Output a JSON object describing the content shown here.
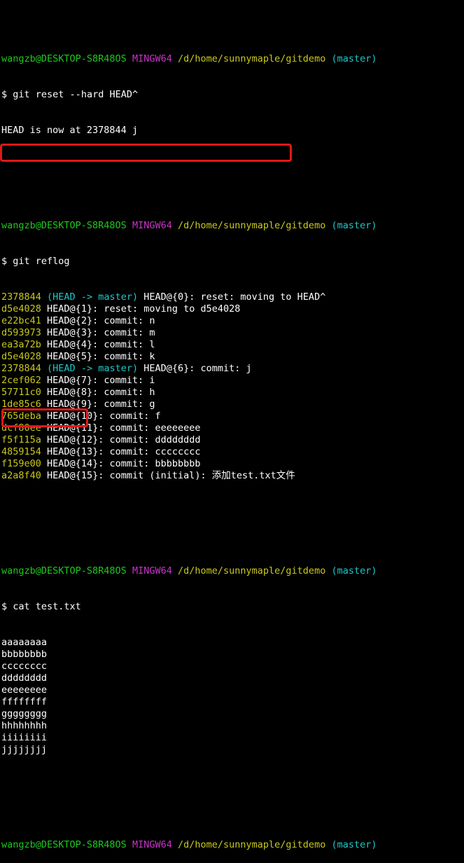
{
  "prompt": {
    "user_host": "wangzb@DESKTOP-S8R48OS",
    "shell": "MINGW64",
    "path": "/d/home/sunnymaple/gitdemo",
    "branch": "(master)",
    "symbol": "$"
  },
  "block1": {
    "command": "git reset --hard HEAD^",
    "output": "HEAD is now at 2378844 j"
  },
  "block2": {
    "command": "git reflog",
    "entries": [
      {
        "hash": "2378844",
        "ref": "(HEAD -> master)",
        "rest": "HEAD@{0}: reset: moving to HEAD^"
      },
      {
        "hash": "d5e4028",
        "ref": "",
        "rest": "HEAD@{1}: reset: moving to d5e4028"
      },
      {
        "hash": "e22bc41",
        "ref": "",
        "rest": "HEAD@{2}: commit: n"
      },
      {
        "hash": "d593973",
        "ref": "",
        "rest": "HEAD@{3}: commit: m"
      },
      {
        "hash": "ea3a72b",
        "ref": "",
        "rest": "HEAD@{4}: commit: l"
      },
      {
        "hash": "d5e4028",
        "ref": "",
        "rest": "HEAD@{5}: commit: k"
      },
      {
        "hash": "2378844",
        "ref": "(HEAD -> master)",
        "rest": "HEAD@{6}: commit: j"
      },
      {
        "hash": "2cef062",
        "ref": "",
        "rest": "HEAD@{7}: commit: i"
      },
      {
        "hash": "57711c0",
        "ref": "",
        "rest": "HEAD@{8}: commit: h"
      },
      {
        "hash": "1de85c6",
        "ref": "",
        "rest": "HEAD@{9}: commit: g"
      },
      {
        "hash": "765deba",
        "ref": "",
        "rest": "HEAD@{10}: commit: f"
      },
      {
        "hash": "dcf80ee",
        "ref": "",
        "rest": "HEAD@{11}: commit: eeeeeeee"
      },
      {
        "hash": "f5f115a",
        "ref": "",
        "rest": "HEAD@{12}: commit: dddddddd"
      },
      {
        "hash": "4859154",
        "ref": "",
        "rest": "HEAD@{13}: commit: cccccccc"
      },
      {
        "hash": "f159e00",
        "ref": "",
        "rest": "HEAD@{14}: commit: bbbbbbbb"
      },
      {
        "hash": "a2a8f40",
        "ref": "",
        "rest": "HEAD@{15}: commit (initial): 添加test.txt文件"
      }
    ]
  },
  "block3": {
    "command": "cat test.txt",
    "lines": [
      "aaaaaaaa",
      "bbbbbbbb",
      "cccccccc",
      "dddddddd",
      "eeeeeeee",
      "ffffffff",
      "gggggggg",
      "hhhhhhhh",
      "iiiiiiii",
      "jjjjjjjj"
    ]
  },
  "colors": {
    "background": "#000000",
    "user_host": "#1ec81e",
    "shell": "#c834c8",
    "path": "#c8c81e",
    "branch": "#1ec8c8",
    "hash": "#c8c81e",
    "ref": "#1ec8c8",
    "highlight": "#e01818"
  }
}
